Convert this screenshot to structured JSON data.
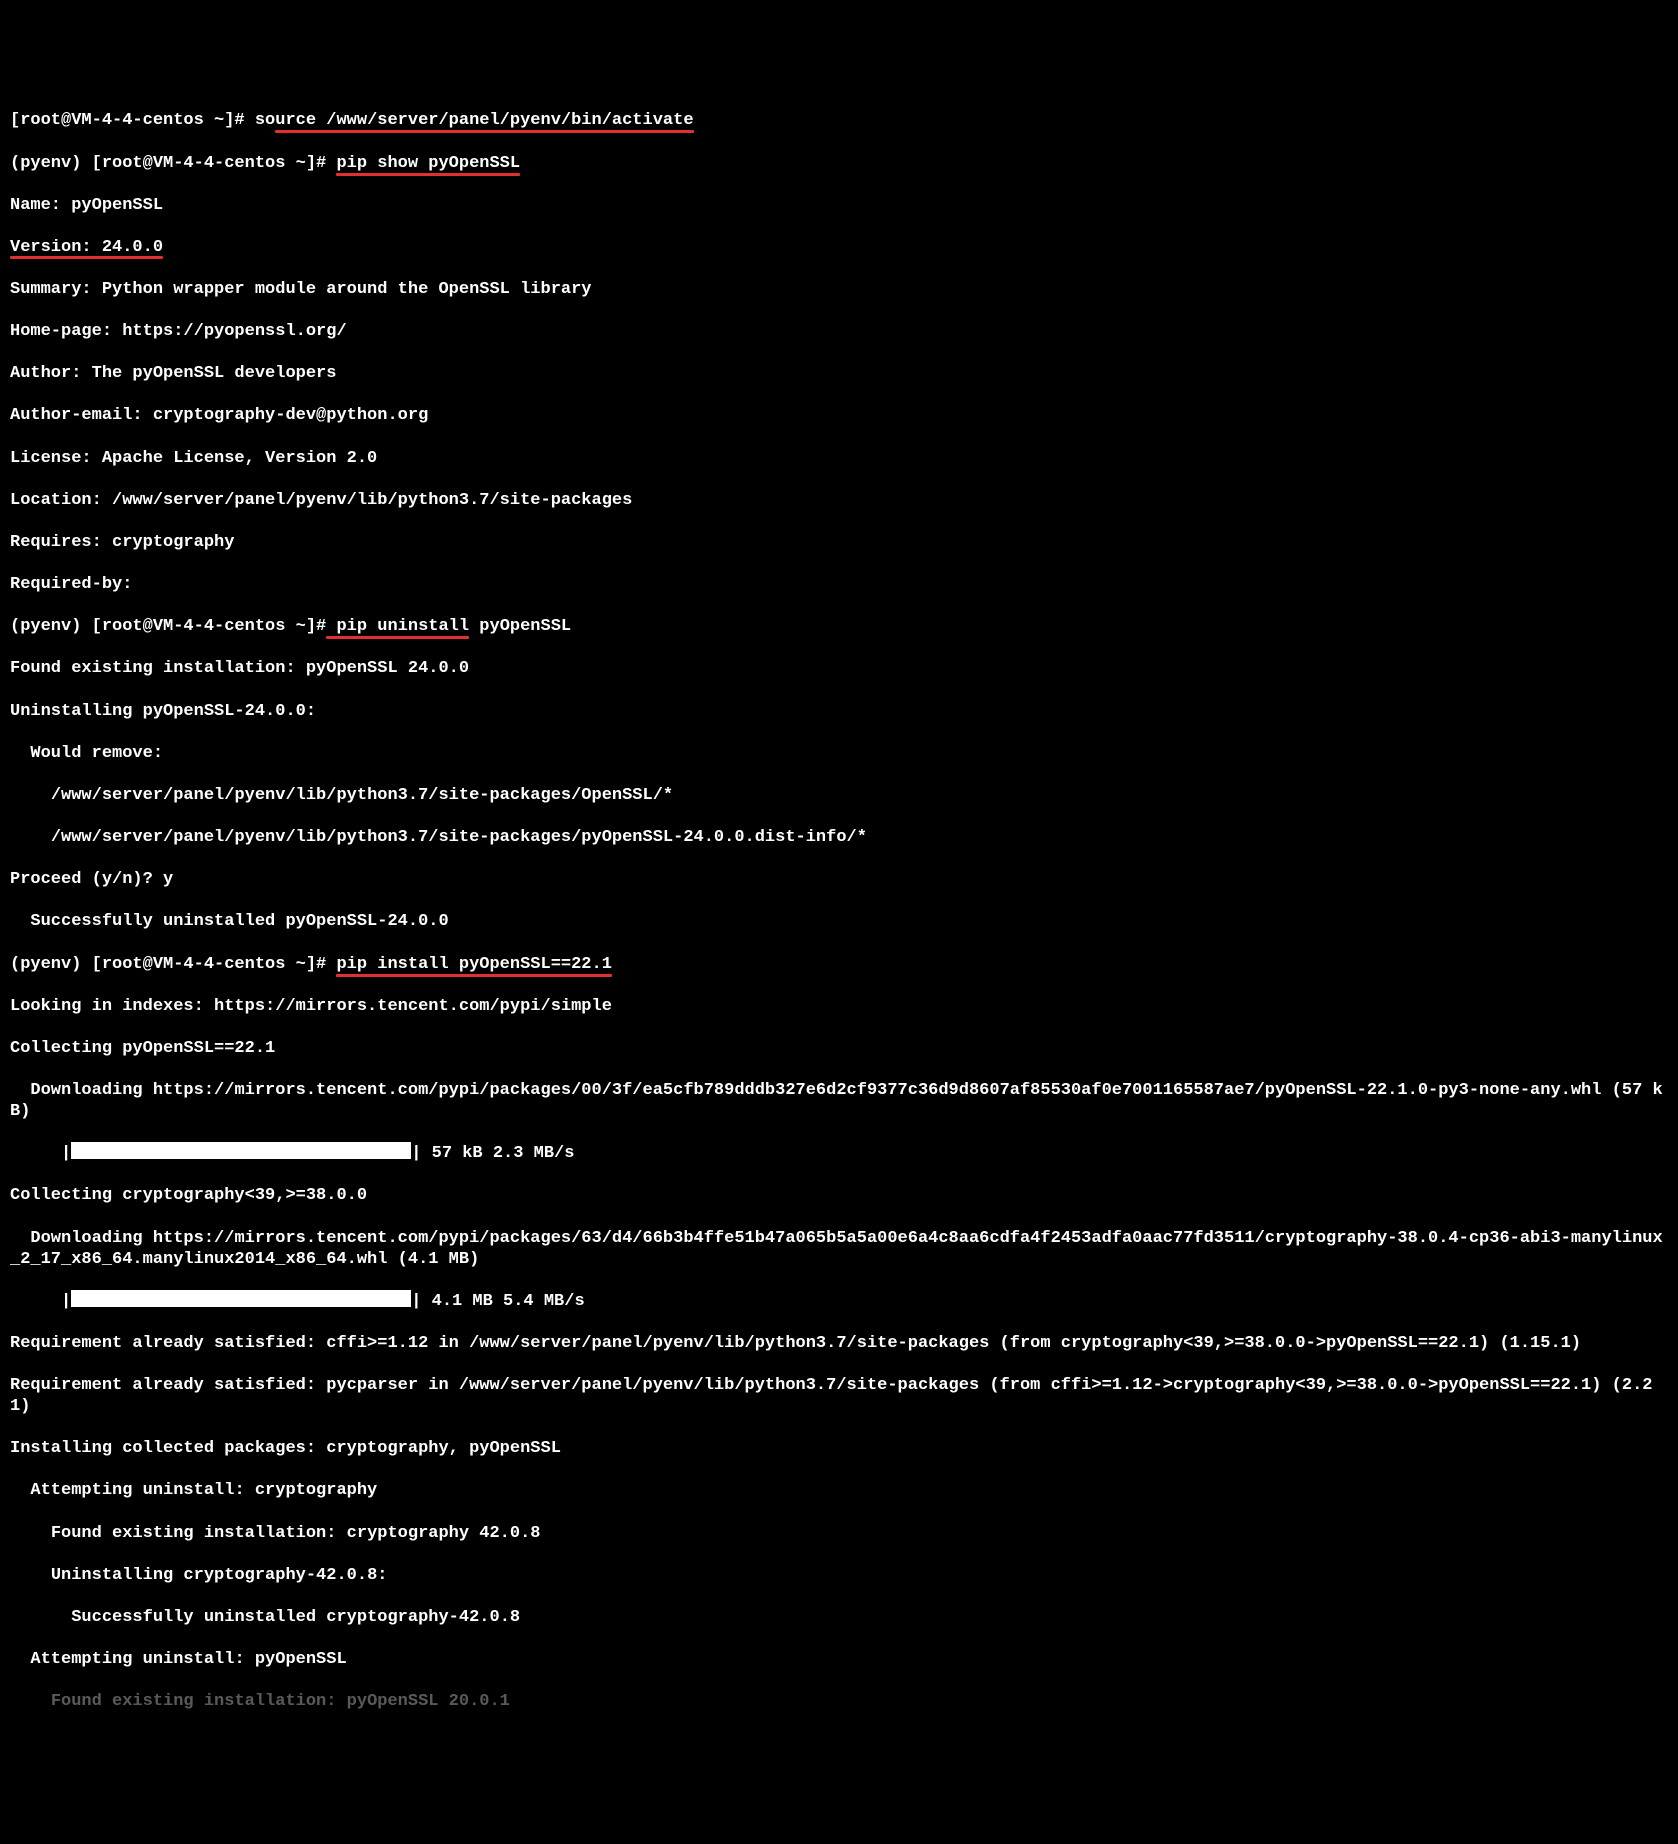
{
  "lines": {
    "l1_prompt": "[root@VM-4-4-centos ~]# ",
    "l1_cmd_a": "so",
    "l1_cmd_b": "urce /www/server/panel/pyenv/bin/activate",
    "l2_prompt": "(pyenv) [root@VM-4-4-centos ~]# ",
    "l2_cmd": "pip show pyOpenSSL",
    "l3": "Name: pyOpenSSL",
    "l4": "Version: 24.0.0",
    "l5": "Summary: Python wrapper module around the OpenSSL library",
    "l6": "Home-page: https://pyopenssl.org/",
    "l7": "Author: The pyOpenSSL developers",
    "l8": "Author-email: cryptography-dev@python.org",
    "l9": "License: Apache License, Version 2.0",
    "l10": "Location: /www/server/panel/pyenv/lib/python3.7/site-packages",
    "l11": "Requires: cryptography",
    "l12": "Required-by:",
    "l13_prompt": "(pyenv) [root@VM-4-4-centos ~]#",
    "l13_cmd": " pip uninstall",
    "l13_arg": " pyOpenSSL",
    "l14": "Found existing installation: pyOpenSSL 24.0.0",
    "l15": "Uninstalling pyOpenSSL-24.0.0:",
    "l16": "  Would remove:",
    "l17": "    /www/server/panel/pyenv/lib/python3.7/site-packages/OpenSSL/*",
    "l18": "    /www/server/panel/pyenv/lib/python3.7/site-packages/pyOpenSSL-24.0.0.dist-info/*",
    "l19": "Proceed (y/n)? y",
    "l20": "  Successfully uninstalled pyOpenSSL-24.0.0",
    "l21_prompt": "(pyenv) [root@VM-4-4-centos ~]# ",
    "l21_cmd": "pip install pyOpenSSL==22.1",
    "l22": "Looking in indexes: https://mirrors.tencent.com/pypi/simple",
    "l23": "Collecting pyOpenSSL==22.1",
    "l24": "  Downloading https://mirrors.tencent.com/pypi/packages/00/3f/ea5cfb789dddb327e6d2cf9377c36d9d8607af85530af0e7001165587ae7/pyOpenSSL-22.1.0-py3-none-any.whl (57 kB)",
    "l25_pre": "     |",
    "l25_post": "| 57 kB 2.3 MB/s",
    "l26": "Collecting cryptography<39,>=38.0.0",
    "l27": "  Downloading https://mirrors.tencent.com/pypi/packages/63/d4/66b3b4ffe51b47a065b5a5a00e6a4c8aa6cdfa4f2453adfa0aac77fd3511/cryptography-38.0.4-cp36-abi3-manylinux_2_17_x86_64.manylinux2014_x86_64.whl (4.1 MB)",
    "l28_pre": "     |",
    "l28_post": "| 4.1 MB 5.4 MB/s",
    "l29": "Requirement already satisfied: cffi>=1.12 in /www/server/panel/pyenv/lib/python3.7/site-packages (from cryptography<39,>=38.0.0->pyOpenSSL==22.1) (1.15.1)",
    "l30": "Requirement already satisfied: pycparser in /www/server/panel/pyenv/lib/python3.7/site-packages (from cffi>=1.12->cryptography<39,>=38.0.0->pyOpenSSL==22.1) (2.21)",
    "l31": "Installing collected packages: cryptography, pyOpenSSL",
    "l32": "  Attempting uninstall: cryptography",
    "l33": "    Found existing installation: cryptography 42.0.8",
    "l34": "    Uninstalling cryptography-42.0.8:",
    "l35": "      Successfully uninstalled cryptography-42.0.8",
    "l36": "  Attempting uninstall: pyOpenSSL",
    "l37": "    Found existing installation: pyOpenSSL 20.0.1"
  }
}
